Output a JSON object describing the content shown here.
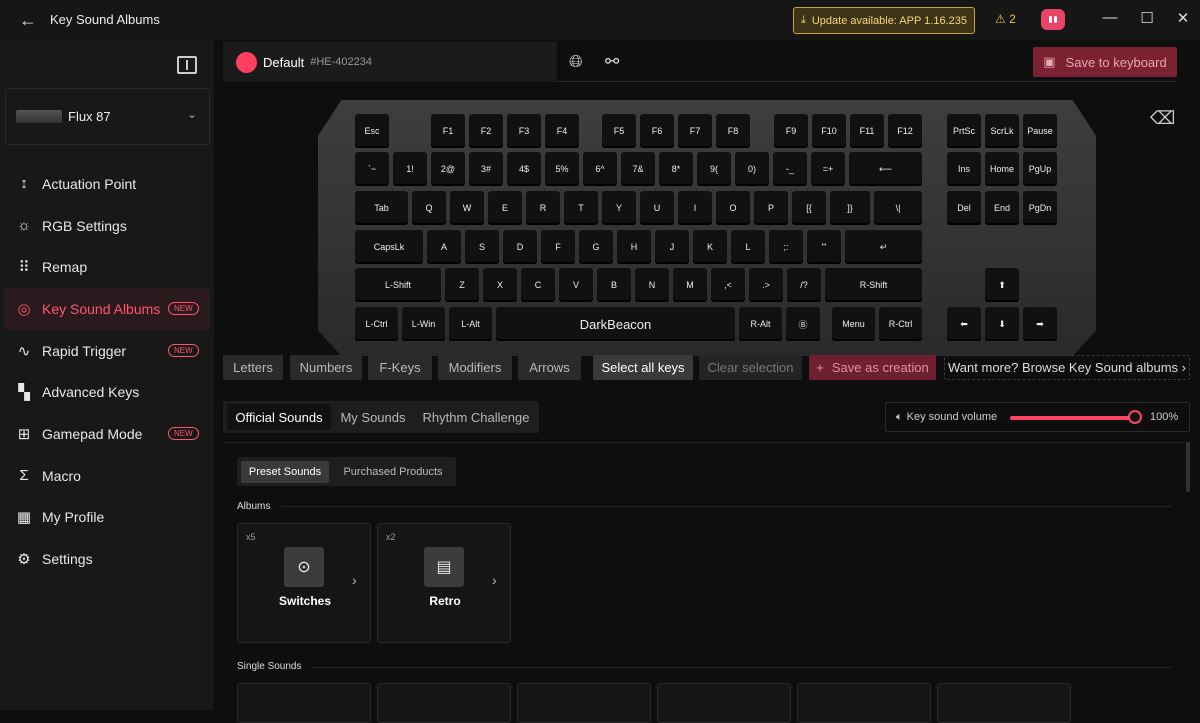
{
  "titlebar": {
    "title": "Key Sound Albums",
    "update": "Update available: APP 1.16.235",
    "warnings": "2"
  },
  "sidebar": {
    "device": "Flux 87",
    "items": [
      {
        "label": "Actuation Point",
        "icon": "↕",
        "badge": ""
      },
      {
        "label": "RGB Settings",
        "icon": "☼",
        "badge": ""
      },
      {
        "label": "Remap",
        "icon": "⠿",
        "badge": ""
      },
      {
        "label": "Key Sound Albums",
        "icon": "◎",
        "badge": "NEW"
      },
      {
        "label": "Rapid Trigger",
        "icon": "∿",
        "badge": "NEW"
      },
      {
        "label": "Advanced Keys",
        "icon": "▚",
        "badge": ""
      },
      {
        "label": "Gamepad Mode",
        "icon": "⊞",
        "badge": "NEW"
      },
      {
        "label": "Macro",
        "icon": "Σ",
        "badge": ""
      },
      {
        "label": "My Profile",
        "icon": "▦",
        "badge": ""
      },
      {
        "label": "Settings",
        "icon": "⚙",
        "badge": ""
      }
    ]
  },
  "profile": {
    "name": "Default",
    "id": "#HE-402234",
    "color": "#ff4060",
    "save": "Save to keyboard"
  },
  "keyboard": {
    "rows": [
      [
        "Esc",
        "F1",
        "F2",
        "F3",
        "F4",
        "F5",
        "F6",
        "F7",
        "F8",
        "F9",
        "F10",
        "F11",
        "F12",
        "PrtSc",
        "ScrLk",
        "Pause"
      ],
      [
        "`~",
        "1!",
        "2@",
        "3#",
        "4$",
        "5%",
        "6^",
        "7&",
        "8*",
        "9(",
        "0)",
        "-_",
        "=+",
        "⟵",
        "Ins",
        "Home",
        "PgUp"
      ],
      [
        "Tab",
        "Q",
        "W",
        "E",
        "R",
        "T",
        "Y",
        "U",
        "I",
        "O",
        "P",
        "[{",
        "]}",
        "\\|",
        "Del",
        "End",
        "PgDn"
      ],
      [
        "CapsLk",
        "A",
        "S",
        "D",
        "F",
        "G",
        "H",
        "J",
        "K",
        "L",
        ";:",
        "'\"",
        "↵"
      ],
      [
        "L-Shift",
        "Z",
        "X",
        "C",
        "V",
        "B",
        "N",
        "M",
        ",<",
        ".>",
        "/?",
        "R-Shift",
        "⬆"
      ],
      [
        "L-Ctrl",
        "L-Win",
        "L-Alt",
        "DarkBeacon",
        "R-Alt",
        "Ⓑ",
        "Menu",
        "R-Ctrl",
        "⬅",
        "⬇",
        "➡"
      ]
    ]
  },
  "categories": [
    "Letters",
    "Numbers",
    "F-Keys",
    "Modifiers",
    "Arrows",
    "Select all keys",
    "Clear selection",
    "Save as creation",
    "Want more? Browse Key Sound albums ›"
  ],
  "tabs": [
    "Official Sounds",
    "My Sounds",
    "Rhythm Challenge"
  ],
  "volume": {
    "label": "Key sound volume",
    "value": "100%"
  },
  "subtabs": [
    "Preset Sounds",
    "Purchased Products"
  ],
  "sections": {
    "albums": "Albums",
    "single": "Single Sounds"
  },
  "albums": [
    {
      "count": "x5",
      "name": "Switches",
      "icon": "⊙"
    },
    {
      "count": "x2",
      "name": "Retro",
      "icon": "▤"
    }
  ]
}
